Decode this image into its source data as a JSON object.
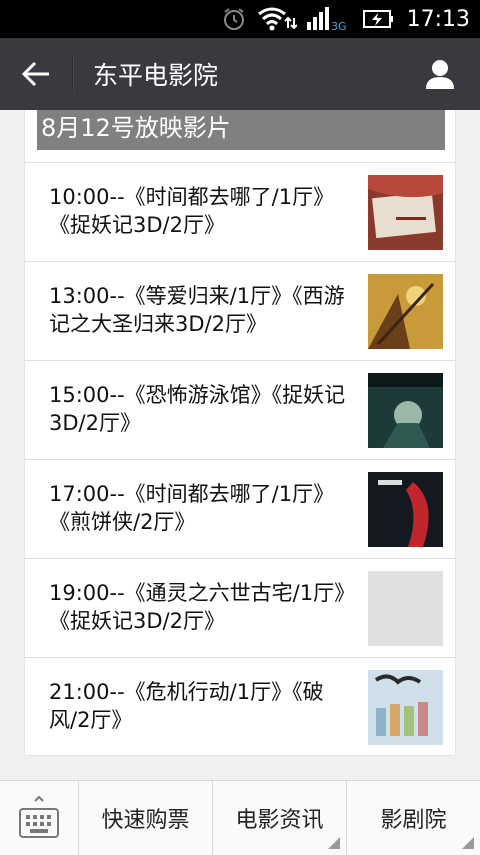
{
  "status_bar": {
    "time": "17:13",
    "network": "3G"
  },
  "header": {
    "title": "东平电影院"
  },
  "schedule": {
    "date_heading": "8月12号放映影片",
    "shows": [
      {
        "text": "10:00--《时间都去哪了/1厅》《捉妖记3D/2厅》",
        "poster_color": "#b8483a"
      },
      {
        "text": "13:00--《等爱归来/1厅》《西游记之大圣归来3D/2厅》",
        "poster_color": "#c89a3a"
      },
      {
        "text": "15:00--《恐怖游泳馆》《捉妖记3D/2厅》",
        "poster_color": "#1e3a38"
      },
      {
        "text": "17:00--《时间都去哪了/1厅》《煎饼侠/2厅》",
        "poster_color": "#14181f"
      },
      {
        "text": "19:00--《通灵之六世古宅/1厅》《捉妖记3D/2厅》",
        "poster_color": "#e0e0e0"
      },
      {
        "text": "21:00--《危机行动/1厅》《破风/2厅》",
        "poster_color": "#8fb3c6"
      }
    ]
  },
  "bottom_menu": {
    "items": [
      "快速购票",
      "电影资讯",
      "影剧院"
    ]
  },
  "colors": {
    "title_bar": "#393a3f",
    "date_header": "#808080"
  }
}
